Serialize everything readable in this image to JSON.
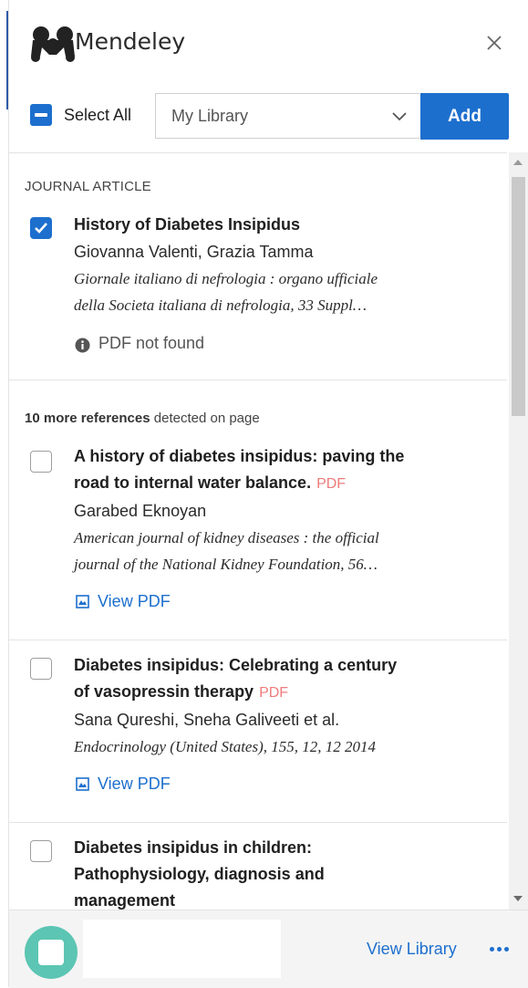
{
  "header": {
    "brand": "Mendeley"
  },
  "toolbar": {
    "select_all_label": "Select All",
    "library_value": "My Library",
    "add_label": "Add"
  },
  "section": {
    "label": "JOURNAL ARTICLE"
  },
  "primary_item": {
    "checked": true,
    "title": "History of Diabetes Insipidus",
    "authors": "Giovanna Valenti, Grazia Tamma",
    "journal_line1": "Giornale italiano di nefrologia : organo ufficiale",
    "journal_line2": "della Societa italiana di nefrologia, 33 Suppl…",
    "pdf_status": "PDF not found"
  },
  "more_refs": {
    "count_text": "10 more references",
    "suffix": " detected on page"
  },
  "references": [
    {
      "title_line1": "A history of diabetes insipidus: paving the",
      "title_line2": "road to internal water balance.",
      "pdf_tag": "PDF",
      "authors": "Garabed Eknoyan",
      "journal_line1": "American journal of kidney diseases : the official",
      "journal_line2": "journal of the National Kidney Foundation, 56…",
      "view_pdf": "View PDF"
    },
    {
      "title_line1": "Diabetes insipidus: Celebrating a century",
      "title_line2": "of vasopressin therapy",
      "pdf_tag": "PDF",
      "authors": "Sana Qureshi, Sneha Galiveeti et al.",
      "journal_line1": "Endocrinology (United States), 155, 12, 12 2014",
      "view_pdf": "View PDF"
    },
    {
      "title_line1": "Diabetes insipidus in children:",
      "title_line2": "Pathophysiology, diagnosis and",
      "title_line3": "management"
    }
  ],
  "footer": {
    "view_library": "View Library"
  },
  "colors": {
    "accent": "#1d6fce",
    "pdf_tag": "#ee7b7b",
    "avatar": "#5cc5b3"
  },
  "icons": [
    "mendeley-logo",
    "close-icon",
    "chevron-down-icon",
    "info-icon",
    "pdf-file-icon",
    "more-dots-icon"
  ]
}
